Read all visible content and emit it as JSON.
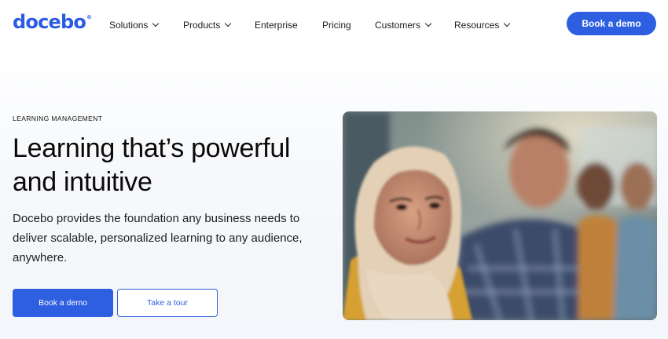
{
  "header": {
    "logo": "docebo",
    "logo_mark": "®",
    "nav": [
      {
        "label": "Solutions",
        "has_dropdown": true
      },
      {
        "label": "Products",
        "has_dropdown": true
      },
      {
        "label": "Enterprise",
        "has_dropdown": false
      },
      {
        "label": "Pricing",
        "has_dropdown": false
      },
      {
        "label": "Customers",
        "has_dropdown": true
      },
      {
        "label": "Resources",
        "has_dropdown": true
      }
    ],
    "cta": "Book a demo"
  },
  "hero": {
    "eyebrow": "LEARNING MANAGEMENT",
    "title": "Learning that’s powerful and intuitive",
    "description": "Docebo provides the foundation any business needs to deliver scalable, personalized learning to any audience, anywhere.",
    "primary_button": "Book a demo",
    "secondary_button": "Take a tour"
  },
  "colors": {
    "brand_blue": "#2d5fe0",
    "text": "#0a0a0a"
  },
  "icons": [
    "chevron-down-icon"
  ]
}
